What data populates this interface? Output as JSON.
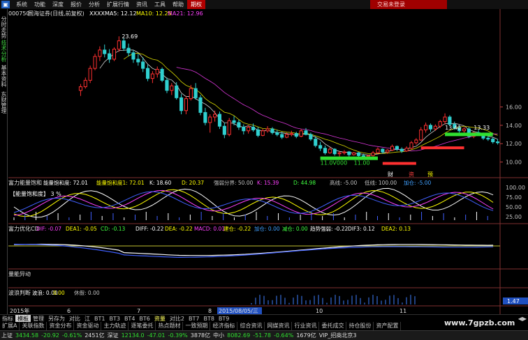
{
  "menubar": {
    "items": [
      "系统",
      "功能",
      "深度",
      "报价",
      "分析",
      "扩展行情",
      "资讯",
      "工具",
      "帮助",
      "期权"
    ],
    "active_index": 9,
    "right_label": "交易未登录"
  },
  "left_tabs": [
    {
      "label": "分时走势",
      "color": "white"
    },
    {
      "label": "技术分析",
      "color": "green"
    },
    {
      "label": "基本资料",
      "color": "white"
    },
    {
      "label": "东财管理",
      "color": "white"
    }
  ],
  "main_chart": {
    "stock_code": "000750",
    "stock_name": "国海证券(日线,前复权)",
    "suffix": "XXXX",
    "ma_labels": [
      {
        "text": "MA5: 12.12",
        "color": "#ffffff"
      },
      {
        "text": "MA10: 12.25",
        "color": "#ffff00"
      },
      {
        "text": "MA21: 12.96",
        "color": "#ff40ff"
      }
    ],
    "max_label": "23.69",
    "price_labels": [
      "13.40",
      "13.33"
    ],
    "bottom_labels": [
      "11.0V000",
      "11.00"
    ],
    "y_ticks": [
      "16.00",
      "14.00",
      "12.00",
      "10.00"
    ],
    "y_values": [
      16,
      14,
      12,
      10
    ],
    "yrange": [
      8.6,
      25.6
    ],
    "markers": [
      "财",
      "资",
      "预"
    ],
    "candles": [
      [
        17.8,
        18.5,
        17.2,
        18.2
      ],
      [
        18.2,
        19.2,
        18.0,
        18.9
      ],
      [
        18.9,
        20.5,
        18.6,
        20.2
      ],
      [
        20.2,
        21.8,
        20.0,
        21.5
      ],
      [
        21.5,
        22.6,
        21.0,
        22.2
      ],
      [
        22.2,
        22.8,
        21.4,
        21.8
      ],
      [
        21.8,
        22.3,
        20.8,
        21.2
      ],
      [
        21.2,
        22.5,
        21.0,
        22.3
      ],
      [
        22.3,
        23.69,
        22.0,
        23.2
      ],
      [
        23.2,
        23.5,
        22.1,
        22.4
      ],
      [
        22.4,
        22.9,
        21.5,
        21.9
      ],
      [
        21.9,
        22.2,
        20.8,
        21.2
      ],
      [
        21.2,
        21.8,
        20.5,
        20.9
      ],
      [
        20.9,
        21.4,
        19.8,
        20.2
      ],
      [
        20.2,
        20.6,
        18.8,
        19.1
      ],
      [
        19.1,
        19.9,
        18.6,
        19.6
      ],
      [
        19.6,
        20.4,
        19.2,
        20.1
      ],
      [
        20.1,
        20.3,
        18.7,
        18.9
      ],
      [
        18.9,
        19.2,
        17.5,
        17.8
      ],
      [
        17.8,
        18.6,
        17.3,
        18.3
      ],
      [
        18.3,
        18.7,
        16.8,
        17.0
      ],
      [
        17.0,
        17.4,
        15.2,
        15.6
      ],
      [
        15.6,
        17.2,
        15.2,
        16.9
      ],
      [
        16.9,
        18.4,
        16.7,
        18.0
      ],
      [
        18.0,
        18.6,
        16.8,
        17.0
      ],
      [
        17.0,
        17.3,
        15.1,
        15.4
      ],
      [
        15.4,
        15.9,
        14.0,
        14.3
      ],
      [
        14.3,
        15.2,
        13.2,
        14.9
      ],
      [
        14.9,
        15.6,
        14.4,
        15.2
      ],
      [
        15.2,
        15.5,
        13.6,
        13.9
      ],
      [
        13.9,
        14.3,
        12.6,
        13.0
      ],
      [
        13.0,
        14.8,
        12.8,
        14.5
      ],
      [
        14.5,
        15.0,
        14.0,
        14.3
      ],
      [
        14.3,
        14.6,
        13.5,
        13.8
      ],
      [
        13.8,
        14.1,
        13.0,
        13.4
      ],
      [
        13.4,
        14.0,
        13.1,
        13.8
      ],
      [
        13.8,
        14.2,
        13.3,
        13.5
      ],
      [
        13.5,
        13.8,
        12.7,
        12.9
      ],
      [
        12.9,
        13.6,
        12.8,
        13.4
      ],
      [
        13.4,
        13.9,
        13.2,
        13.6
      ],
      [
        13.6,
        13.8,
        13.0,
        13.2
      ],
      [
        13.2,
        13.5,
        12.8,
        13.0
      ],
      [
        13.0,
        13.3,
        12.5,
        12.7
      ],
      [
        12.7,
        13.2,
        12.6,
        13.0
      ],
      [
        13.0,
        13.4,
        12.8,
        13.1
      ],
      [
        13.1,
        13.3,
        12.6,
        12.8
      ],
      [
        12.8,
        13.6,
        12.7,
        13.4
      ],
      [
        13.4,
        13.7,
        12.9,
        13.0
      ],
      [
        13.0,
        13.2,
        12.3,
        12.5
      ],
      [
        12.5,
        12.8,
        11.6,
        11.8
      ],
      [
        11.8,
        12.2,
        11.2,
        11.5
      ],
      [
        11.5,
        11.8,
        10.8,
        11.0
      ],
      [
        11.0,
        11.6,
        10.9,
        11.4
      ],
      [
        11.4,
        11.5,
        10.7,
        10.9
      ],
      [
        10.9,
        11.2,
        10.6,
        11.0
      ],
      [
        11.0,
        11.3,
        10.8,
        11.1
      ],
      [
        11.1,
        11.2,
        10.6,
        10.8
      ],
      [
        10.8,
        11.1,
        10.7,
        11.0
      ],
      [
        11.0,
        11.1,
        10.5,
        10.7
      ],
      [
        10.7,
        10.9,
        10.4,
        10.6
      ],
      [
        10.6,
        10.8,
        10.3,
        10.7
      ],
      [
        10.7,
        11.2,
        10.6,
        11.0
      ],
      [
        11.0,
        11.6,
        10.9,
        11.4
      ],
      [
        11.4,
        11.5,
        10.9,
        11.1
      ],
      [
        11.1,
        11.4,
        10.9,
        11.3
      ],
      [
        11.3,
        11.9,
        11.2,
        11.7
      ],
      [
        11.7,
        11.8,
        11.2,
        11.4
      ],
      [
        11.4,
        11.6,
        11.0,
        11.2
      ],
      [
        11.2,
        11.7,
        11.1,
        11.5
      ],
      [
        11.5,
        12.3,
        11.4,
        12.1
      ],
      [
        12.1,
        12.6,
        11.9,
        12.4
      ],
      [
        12.4,
        13.8,
        12.3,
        13.5
      ],
      [
        13.5,
        14.3,
        13.2,
        14.0
      ],
      [
        14.0,
        14.2,
        13.3,
        13.6
      ],
      [
        13.6,
        14.1,
        13.4,
        13.9
      ],
      [
        13.9,
        14.6,
        13.7,
        14.4
      ],
      [
        14.4,
        15.3,
        14.1,
        14.9
      ],
      [
        14.9,
        15.1,
        13.9,
        14.1
      ],
      [
        14.1,
        14.4,
        13.5,
        13.7
      ],
      [
        13.7,
        14.0,
        13.2,
        13.4
      ],
      [
        13.4,
        13.8,
        13.2,
        13.6
      ],
      [
        13.6,
        13.8,
        12.6,
        12.8
      ],
      [
        12.8,
        13.3,
        12.6,
        13.2
      ],
      [
        13.2,
        13.5,
        12.9,
        13.0
      ],
      [
        13.0,
        13.2,
        12.4,
        12.6
      ],
      [
        12.6,
        12.9,
        12.3,
        12.5
      ],
      [
        12.5,
        12.7,
        12.0,
        12.2
      ],
      [
        12.2,
        12.5,
        11.9,
        12.1
      ]
    ]
  },
  "pane1": {
    "title": "富力能量饱和",
    "items": [
      {
        "text": "能量饱和度: 72.01",
        "color": "#ffffff"
      },
      {
        "text": "能量饱和度1: 72.01",
        "color": "#ffff00"
      },
      {
        "text": "K: 18.60",
        "color": "#ffffff"
      },
      {
        "text": "D: 20.37",
        "color": "#ffff00"
      },
      {
        "text": "强弱分界: 50.00",
        "color": "#c0c0c0"
      },
      {
        "text": "K: 15.39",
        "color": "#ff40ff"
      },
      {
        "text": "D: 44.98",
        "color": "#40ff40"
      },
      {
        "text": "高线: -5.00",
        "color": "#c0c0c0"
      },
      {
        "text": "低线: 100.00",
        "color": "#c0c0c0"
      },
      {
        "text": "加仓: -5.00",
        "color": "#40a0ff"
      }
    ],
    "legend": "【能量饱和度】 3 %",
    "y_ticks": [
      "100.00",
      "75.00",
      "50.00",
      "25.00"
    ]
  },
  "pane2": {
    "title": "富力优化CD",
    "items": [
      {
        "text": "DIF: -0.07",
        "color": "#ff40ff"
      },
      {
        "text": "DEA1: -0.05",
        "color": "#ffff00"
      },
      {
        "text": "CD: -0.13",
        "color": "#40ff40"
      },
      {
        "text": "DIFF: -0.22",
        "color": "#ffffff"
      },
      {
        "text": "DEA: -0.22",
        "color": "#ffff00"
      },
      {
        "text": "MACD: 0.01",
        "color": "#ff40ff"
      },
      {
        "text": "建仓: -0.22",
        "color": "#ffff00"
      },
      {
        "text": "加仓: 0.00",
        "color": "#40a0ff"
      },
      {
        "text": "减仓: 0.00",
        "color": "#40ff40"
      },
      {
        "text": "趋势强弱: -0.22",
        "color": "#ffffff"
      },
      {
        "text": "DIF3: 0.12",
        "color": "#ffffff"
      },
      {
        "text": "DEA2: 0.13",
        "color": "#ffff00"
      }
    ]
  },
  "pane3": {
    "title": "量能异动"
  },
  "pane4": {
    "title": "波浪判断",
    "items": [
      {
        "text": "波浪: 0.00",
        "color": "#ffffff"
      },
      {
        "text": "0.00",
        "color": "#ffff00"
      },
      {
        "text": "休假: 0.00",
        "color": "#c0c0c0"
      }
    ],
    "right_value": "1.47"
  },
  "time_axis": {
    "labels": [
      "2015年",
      "6",
      "7",
      "8",
      "2015/08/05/三",
      "10",
      "11"
    ]
  },
  "tabs": {
    "items": [
      "指标",
      "模板",
      "管理",
      "另存为",
      "对比",
      "江",
      "BT1",
      "BT3",
      "BT4",
      "BT6",
      "资量",
      "对比2",
      "BT7",
      "BT8",
      "BT9"
    ],
    "active_index": 1,
    "highlight_index": 10
  },
  "function_tabs": [
    "扩展A",
    "关联指数",
    "资金分布",
    "资金驱动",
    "主力轨迹",
    "逐笔委托",
    "热点题材",
    "一致预期",
    "经济指标",
    "综合资讯",
    "网媒资讯",
    "行业资讯",
    "委托成交",
    "持仓股份",
    "资产配置"
  ],
  "status": {
    "items": [
      {
        "text": "上证",
        "color": "#e0e0e0"
      },
      {
        "text": "3434.58",
        "color": "#30e030"
      },
      {
        "text": "-20.92",
        "color": "#30e030"
      },
      {
        "text": "-0.61%",
        "color": "#30e030"
      },
      {
        "text": "2451亿",
        "color": "#e0e0e0"
      },
      {
        "text": "深证",
        "color": "#e0e0e0"
      },
      {
        "text": "12134.0",
        "color": "#30e030"
      },
      {
        "text": "-47.01",
        "color": "#30e030"
      },
      {
        "text": "-0.39%",
        "color": "#30e030"
      },
      {
        "text": "3878亿",
        "color": "#e0e0e0"
      },
      {
        "text": "中小",
        "color": "#e0e0e0"
      },
      {
        "text": "8082.69",
        "color": "#30e030"
      },
      {
        "text": "-51.78",
        "color": "#30e030"
      },
      {
        "text": "-0.64%",
        "color": "#30e030"
      },
      {
        "text": "1679亿",
        "color": "#e0e0e0"
      },
      {
        "text": "VIP_招商北京3",
        "color": "#e0e0e0"
      }
    ]
  },
  "watermark": "www.7gpzb.com"
}
